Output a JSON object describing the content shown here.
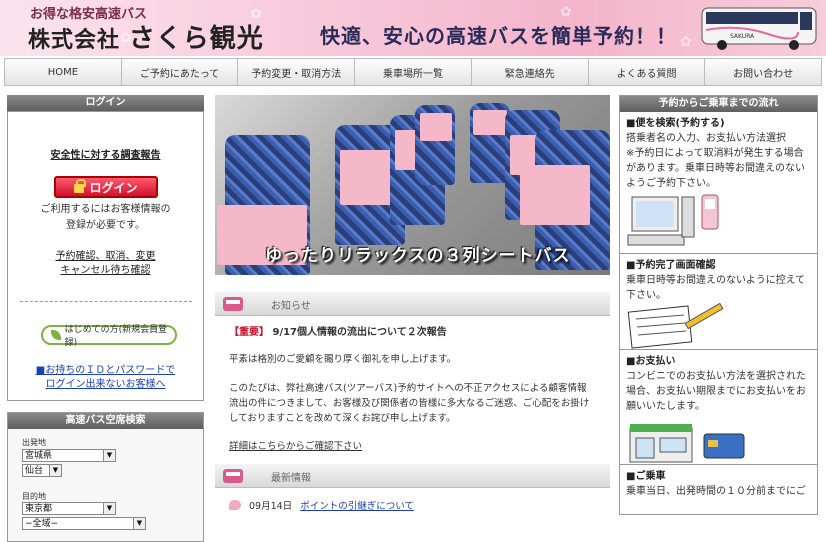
{
  "header": {
    "tagline": "お得な格安高速バス",
    "company_prefix": "株式会社",
    "company_name": "さくら観光",
    "slogan": "快適、安心の高速バスを簡単予約！！",
    "bus_label": "SAKURA"
  },
  "nav": {
    "items": [
      "HOME",
      "ご予約にあたって",
      "予約変更・取消方法",
      "乗車場所一覧",
      "緊急連絡先",
      "よくある質問",
      "お問い合わせ"
    ]
  },
  "login_box": {
    "title": "ログイン",
    "safety_link": "安全性に対する調査報告",
    "login_button": "ログイン",
    "note_line1": "ご利用するにはお客様情報の",
    "note_line2": "登録が必要です。",
    "link_line1": "予約確認、取消、変更",
    "link_line2": "キャンセル待ち確認",
    "first_time_button": "はじめての方(新規会員登録)",
    "forgot_line1": "■お持ちのＩＤとパスワードで",
    "forgot_line2": "ログイン出来ないお客様へ"
  },
  "search_box": {
    "title": "高速バス空席検索",
    "departure_label": "出発地",
    "departure_pref": "宮城県",
    "departure_city": "仙台",
    "destination_label": "目的地",
    "destination_pref": "東京都",
    "destination_area": "−全域−"
  },
  "hero": {
    "caption": "ゆったりリラックスの３列シートバス"
  },
  "notice": {
    "section_title": "お知らせ",
    "tag": "【重要】",
    "headline": "9/17個人情報の流出について２次報告",
    "para1": "平素は格別のご愛顧を賜り厚く御礼を申し上げます。",
    "para2_line1": "このたびは、弊社高速バス(ツアーバス)予約サイトへの不正アクセスによる顧客情報",
    "para2_line2": "流出の件につきまして、お客様及び関係者の皆様に多大なるご迷惑、ご心配をお掛け",
    "para2_line3": "しておりますことを改めて深くお詫び申し上げます。",
    "details_link": "詳細はこちらからご確認下さい"
  },
  "latest": {
    "section_title": "最新情報",
    "date": "09月14日",
    "link": "ポイントの引継ぎについて"
  },
  "flow": {
    "title": "予約からご乗車までの流れ",
    "step1_title": "■便を検索(予約する)",
    "step1_l1": "搭乗者名の入力、お支払い方法選択",
    "step1_l2": "※予約日によって取消料が発生する場合",
    "step1_l3": "があります。乗車日時等お間違えのない",
    "step1_l4": "ようご予約下さい。",
    "step2_title": "■予約完了画面確認",
    "step2_l1": "乗車日時等お間違えのないように控えて",
    "step2_l2": "下さい。",
    "step3_title": "■お支払い",
    "step3_l1": "コンビニでのお支払い方法を選択された",
    "step3_l2": "場合、お支払い期限までにお支払いをお",
    "step3_l3": "願いいたします。",
    "step4_title": "■ご乗車",
    "step4_l1": "乗車当日、出発時間の１０分前までにご"
  },
  "colors": {
    "header_pink": "#f4b5cb",
    "important_red": "#d0102e",
    "link_blue": "#1a3fb8",
    "login_red": "#d2102e"
  }
}
